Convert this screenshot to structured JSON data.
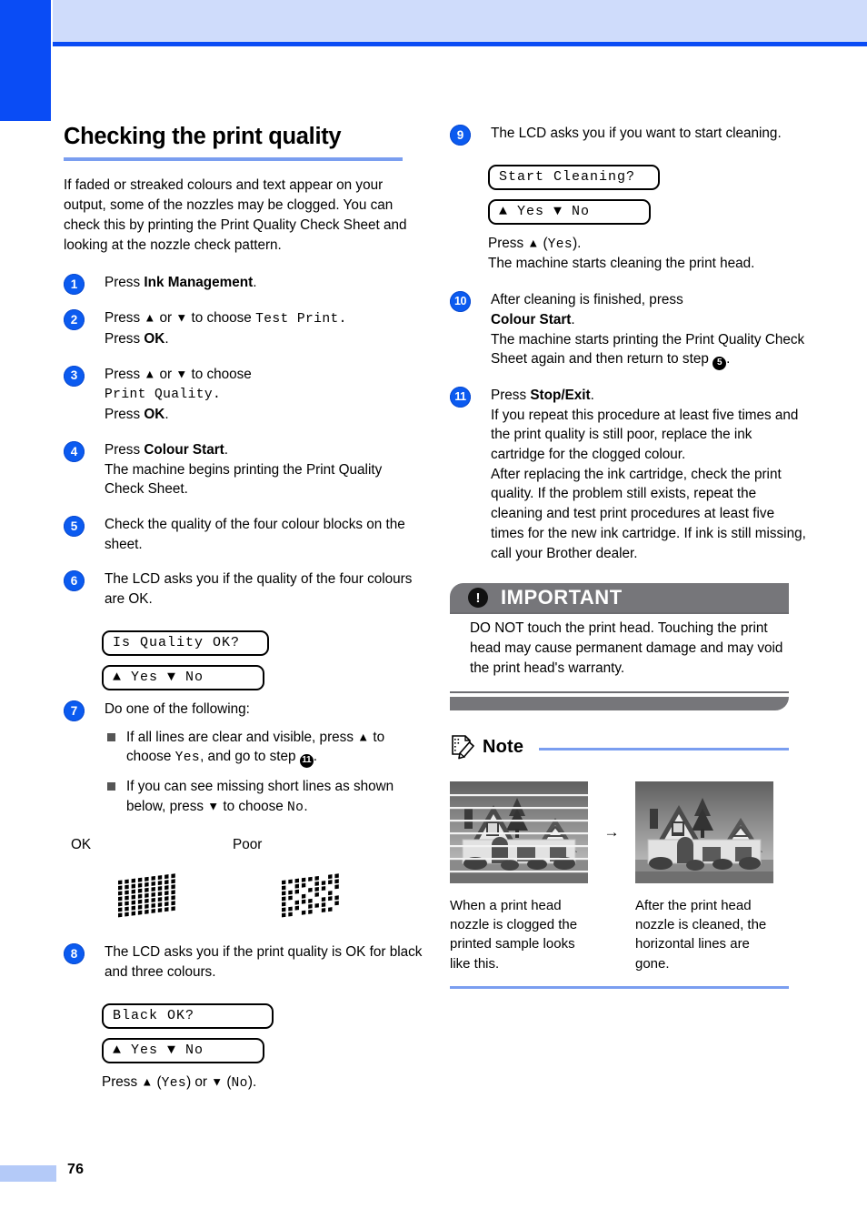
{
  "page": {
    "number": "76",
    "accent_blue": "#0a4cf5",
    "rule_blue": "#7a9ef0",
    "gray_bar": "#76767a"
  },
  "section": {
    "title": "Checking the print quality",
    "intro": "If faded or streaked colours and text appear on your output, some of the nozzles may be clogged. You can check this by printing the Print Quality Check Sheet and looking at the nozzle check pattern."
  },
  "steps": {
    "s1": {
      "num": "1",
      "t1": "Press ",
      "b1": "Ink Management",
      "t2": "."
    },
    "s2": {
      "num": "2",
      "t1": "Press ",
      "up": "▲",
      "t2": " or ",
      "down": "▼",
      "t3": " to choose ",
      "mono": "Test Print.",
      "t4": "Press ",
      "b1": "OK",
      "t5": "."
    },
    "s3": {
      "num": "3",
      "t1": "Press ",
      "up": "▲",
      "t2": " or ",
      "down": "▼",
      "t3": " to choose",
      "mono": "Print Quality.",
      "t4": "Press ",
      "b1": "OK",
      "t5": "."
    },
    "s4": {
      "num": "4",
      "t1": "Press ",
      "b1": "Colour Start",
      "t2": ".",
      "t3": "The machine begins printing the Print Quality Check Sheet."
    },
    "s5": {
      "num": "5",
      "t1": "Check the quality of the four colour blocks on the sheet."
    },
    "s6": {
      "num": "6",
      "t1": "The LCD asks you if the quality of the four colours are OK.",
      "lcd1": "Is Quality OK?",
      "lcd2": "▲ Yes ▼ No"
    },
    "s7": {
      "num": "7",
      "t1": "Do one of the following:",
      "b1a": "If all lines are clear and visible, press ",
      "b1up": "▲",
      "b1b": " to choose ",
      "b1mono": "Yes",
      "b1c": ", and go to step ",
      "b1ref": "11",
      "b1d": ".",
      "b2a": "If you can see missing short lines as shown below, press ",
      "b2down": "▼",
      "b2b": " to choose ",
      "b2mono": "No",
      "b2c": "."
    },
    "s8": {
      "num": "8",
      "t1": "The LCD asks you if the print quality is OK for black and three colours.",
      "lcd1": "Black OK?",
      "lcd2": "▲ Yes ▼ No",
      "p1": "Press ",
      "pup": "▲",
      "p2": " (",
      "pmono1": "Yes",
      "p3": ") or ",
      "pdown": "▼",
      "p4": " (",
      "pmono2": "No",
      "p5": ")."
    },
    "s9": {
      "num": "9",
      "t1": "The LCD asks you if you want to start cleaning.",
      "lcd1": "Start Cleaning?",
      "lcd2": "▲ Yes ▼ No",
      "p1": "Press ",
      "pup": "▲",
      "p2": " (",
      "pmono": "Yes",
      "p3": ").",
      "p4": "The machine starts cleaning the print head."
    },
    "s10": {
      "num": "10",
      "t1": "After cleaning is finished, press ",
      "b1": "Colour Start",
      "t2": ".",
      "t3": "The machine starts printing the Print Quality Check Sheet again and then return to step ",
      "ref": "5",
      "t4": "."
    },
    "s11": {
      "num": "11",
      "t1": "Press ",
      "b1": "Stop/Exit",
      "t2": ".",
      "t3": "If you repeat this procedure at least five times and the print quality is still poor, replace the ink cartridge for the clogged colour.",
      "t4": "After replacing the ink cartridge, check the print quality. If the problem still exists, repeat the cleaning and test print procedures at least five times for the new ink cartridge. If ink is still missing, call your Brother dealer."
    }
  },
  "patterns": {
    "ok_label": "OK",
    "poor_label": "Poor"
  },
  "important": {
    "icon": "!",
    "title": "IMPORTANT",
    "body": "DO NOT touch the print head. Touching the print head may cause permanent damage and may void the print head's warranty."
  },
  "note": {
    "title": "Note",
    "arrow": "→",
    "caption_left": "When a print head nozzle is clogged the printed sample looks like this.",
    "caption_right": "After the print head nozzle is cleaned, the horizontal lines are gone."
  }
}
